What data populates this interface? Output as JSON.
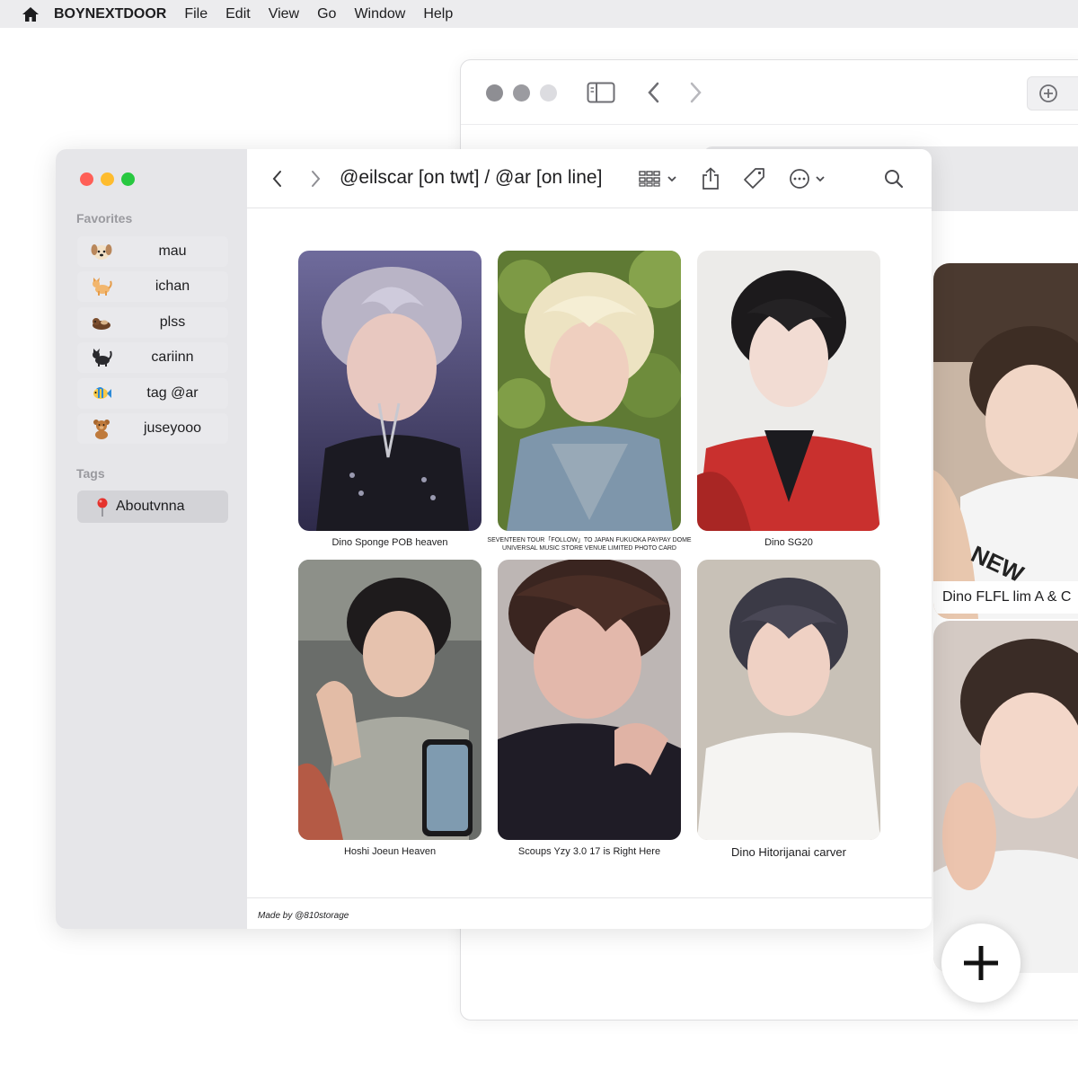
{
  "menubar": {
    "app_name": "BOYNEXTDOOR",
    "items": [
      "File",
      "Edit",
      "View",
      "Go",
      "Window",
      "Help"
    ]
  },
  "back_window": {
    "cards": [
      {
        "caption": "Dino FLFL lim A & C"
      },
      {
        "caption": ""
      }
    ]
  },
  "sidebar": {
    "favorites_title": "Favorites",
    "favorites": [
      {
        "label": "mau",
        "icon": "dog-face-icon"
      },
      {
        "label": "ichan",
        "icon": "cat-icon"
      },
      {
        "label": "plss",
        "icon": "otter-icon"
      },
      {
        "label": "cariinn",
        "icon": "black-cat-icon"
      },
      {
        "label": "tag @ar",
        "icon": "tropical-fish-icon"
      },
      {
        "label": "juseyooo",
        "icon": "teddy-bear-icon"
      }
    ],
    "tags_title": "Tags",
    "tag": {
      "label": "Aboutvnna",
      "icon": "round-pushpin-icon"
    }
  },
  "toolbar": {
    "title": "@eilscar [on twt] / @ar [on line]"
  },
  "grid": {
    "cards": [
      {
        "caption": "Dino Sponge POB heaven"
      },
      {
        "caption_line1": "SEVENTEEN TOUR「FOLLOW」TO JAPAN FUKUOKA PAYPAY DOME",
        "caption_line2": "UNIVERSAL MUSIC STORE VENUE LIMITED PHOTO CARD"
      },
      {
        "caption": "Dino SG20"
      },
      {
        "caption": "Hoshi Joeun Heaven"
      },
      {
        "caption": "Scoups Yzy 3.0 17 is Right Here"
      },
      {
        "caption": "Dino Hitorijanai carver"
      }
    ]
  },
  "footer": {
    "credit": "Made by @810storage"
  },
  "colors": {
    "close": "#ff5f57",
    "minimize": "#febc2e",
    "zoom": "#28c840",
    "sidebar_bg": "#e6e6e9"
  }
}
